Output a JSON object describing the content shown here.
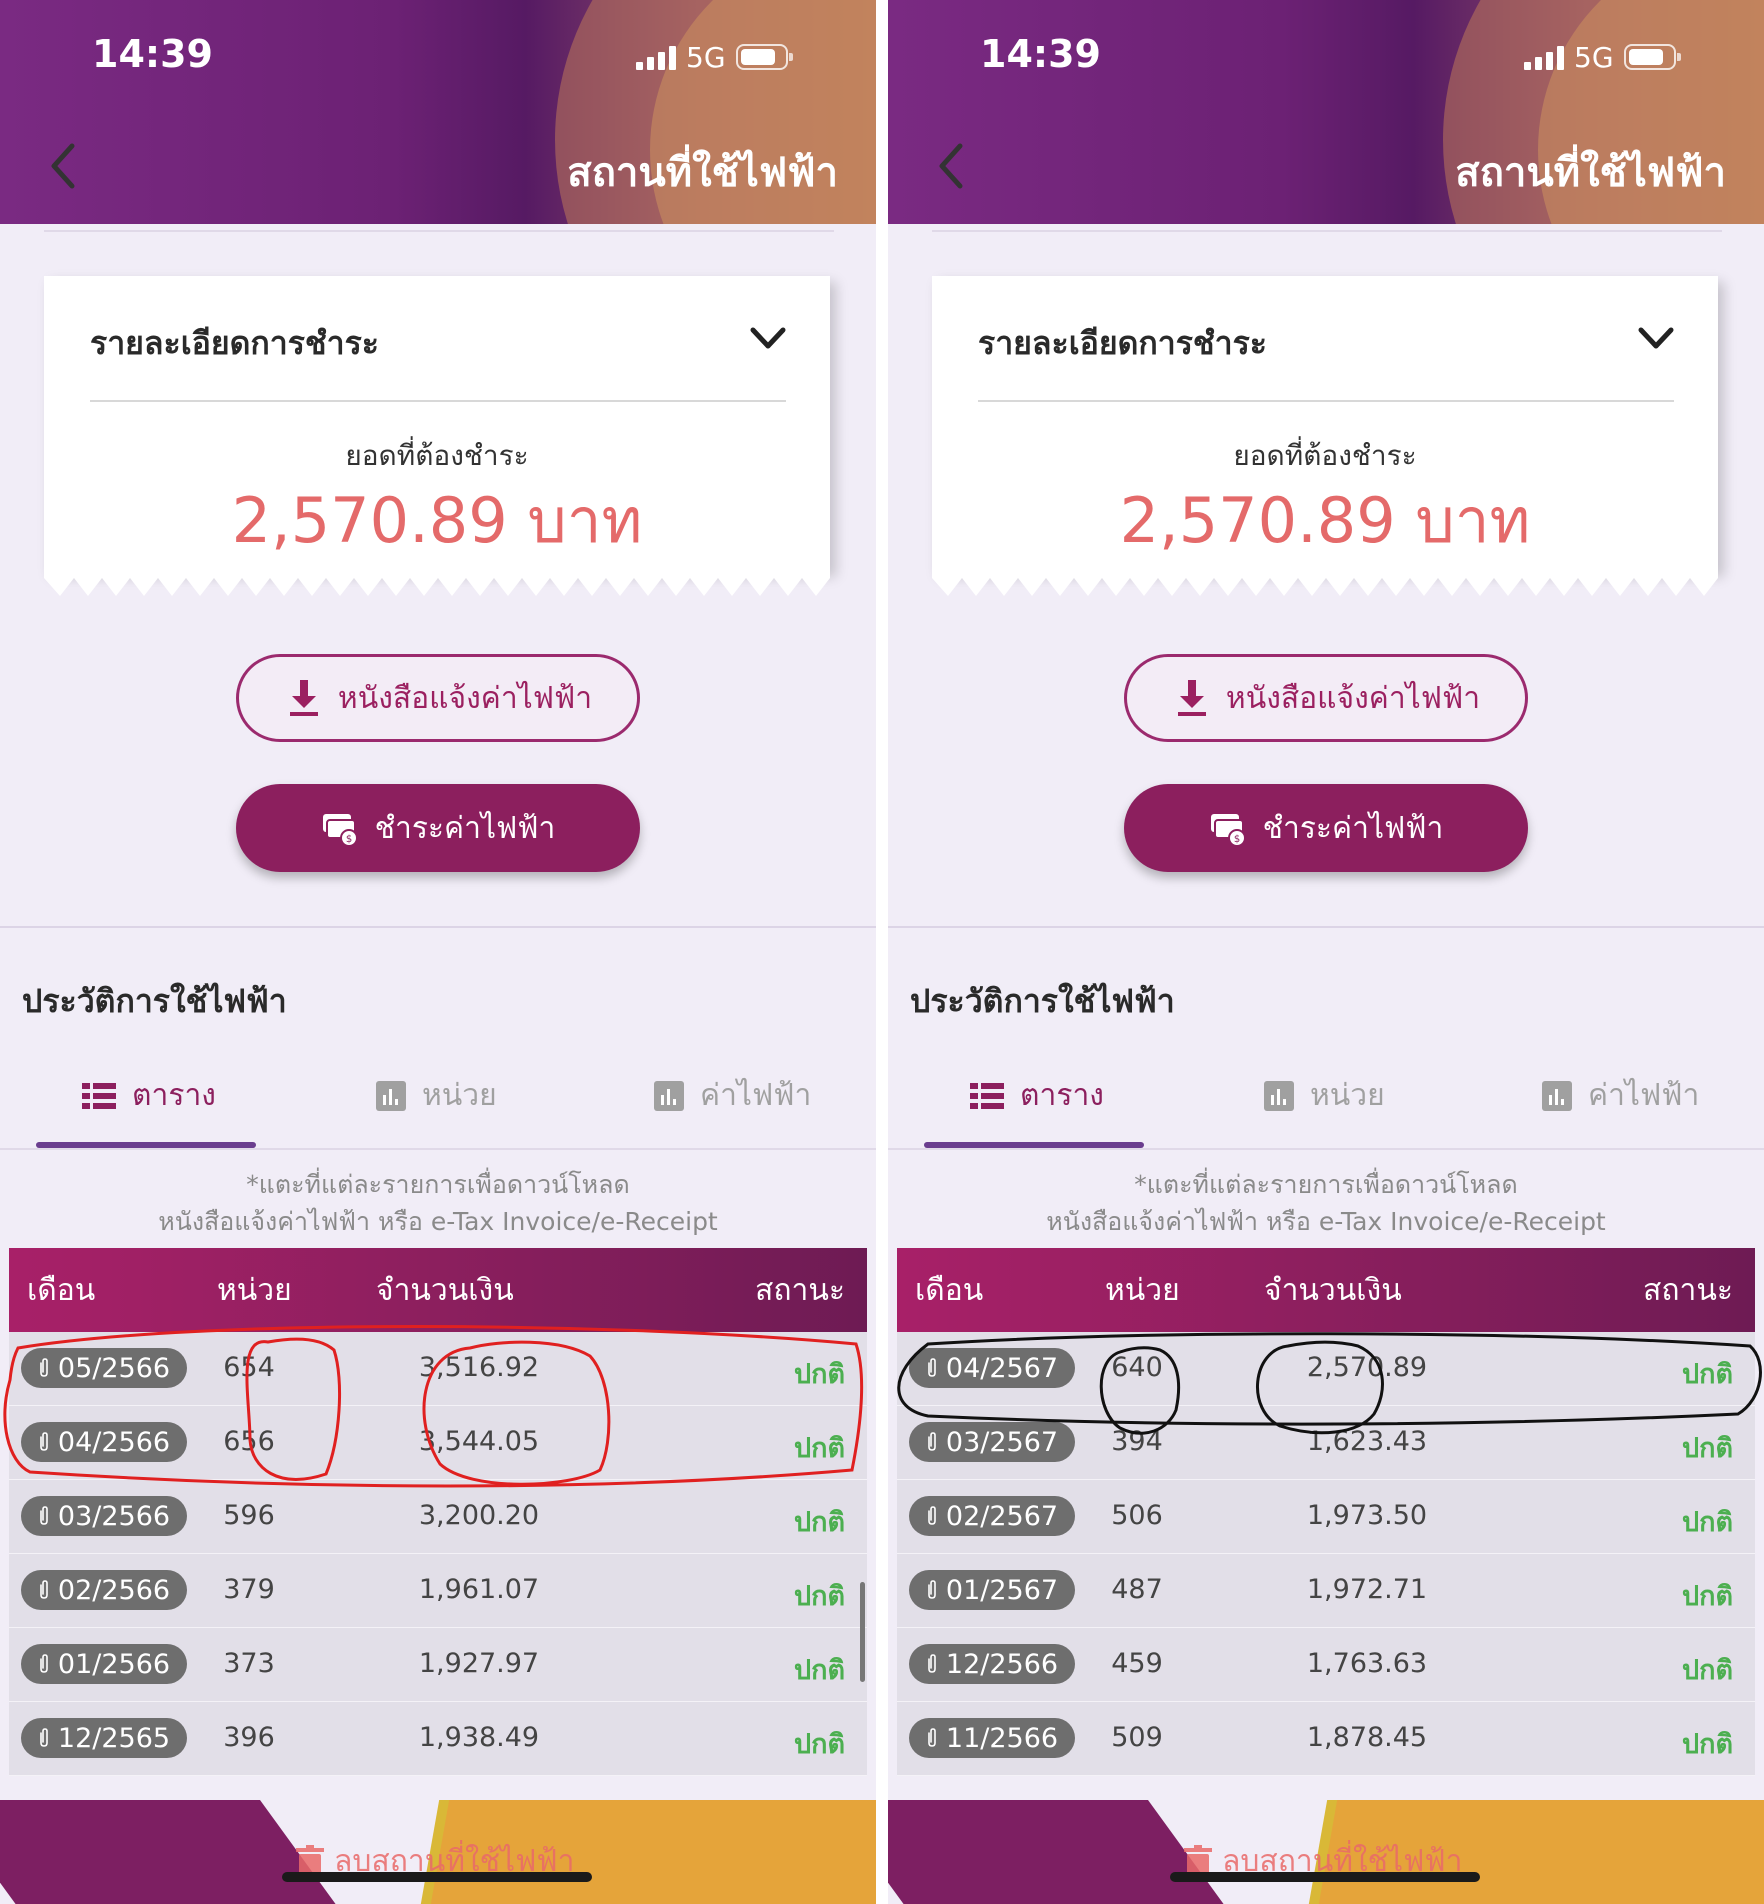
{
  "panels": [
    {
      "status_bar": {
        "time": "14:39",
        "network": "5G"
      },
      "header": {
        "title": "สถานที่ใช้ไฟฟ้า"
      },
      "payment_card": {
        "title": "รายละเอียดการชำระ",
        "due_label": "ยอดที่ต้องชำระ",
        "due_amount": "2,570.89 บาท"
      },
      "buttons": {
        "notice": "หนังสือแจ้งค่าไฟฟ้า",
        "pay": "ชำระค่าไฟฟ้า"
      },
      "history": {
        "title": "ประวัติการใช้ไฟฟ้า",
        "tabs": [
          "ตาราง",
          "หน่วย",
          "ค่าไฟฟ้า"
        ],
        "hint_line1": "*แตะที่แต่ละรายการเพื่อดาวน์โหลด",
        "hint_line2": "หนังสือแจ้งค่าไฟฟ้า หรือ e-Tax Invoice/e-Receipt",
        "columns": [
          "เดือน",
          "หน่วย",
          "จำนวนเงิน",
          "สถานะ"
        ],
        "rows": [
          {
            "month": "05/2566",
            "units": "654",
            "amount": "3,516.92",
            "status": "ปกติ"
          },
          {
            "month": "04/2566",
            "units": "656",
            "amount": "3,544.05",
            "status": "ปกติ"
          },
          {
            "month": "03/2566",
            "units": "596",
            "amount": "3,200.20",
            "status": "ปกติ"
          },
          {
            "month": "02/2566",
            "units": "379",
            "amount": "1,961.07",
            "status": "ปกติ"
          },
          {
            "month": "01/2566",
            "units": "373",
            "amount": "1,927.97",
            "status": "ปกติ"
          },
          {
            "month": "12/2565",
            "units": "396",
            "amount": "1,938.49",
            "status": "ปกติ"
          }
        ]
      },
      "footer": {
        "delete_label": "ลบสถานที่ใช้ไฟฟ้า"
      },
      "annotation_color": "#e02020"
    },
    {
      "status_bar": {
        "time": "14:39",
        "network": "5G"
      },
      "header": {
        "title": "สถานที่ใช้ไฟฟ้า"
      },
      "payment_card": {
        "title": "รายละเอียดการชำระ",
        "due_label": "ยอดที่ต้องชำระ",
        "due_amount": "2,570.89 บาท"
      },
      "buttons": {
        "notice": "หนังสือแจ้งค่าไฟฟ้า",
        "pay": "ชำระค่าไฟฟ้า"
      },
      "history": {
        "title": "ประวัติการใช้ไฟฟ้า",
        "tabs": [
          "ตาราง",
          "หน่วย",
          "ค่าไฟฟ้า"
        ],
        "hint_line1": "*แตะที่แต่ละรายการเพื่อดาวน์โหลด",
        "hint_line2": "หนังสือแจ้งค่าไฟฟ้า หรือ e-Tax Invoice/e-Receipt",
        "columns": [
          "เดือน",
          "หน่วย",
          "จำนวนเงิน",
          "สถานะ"
        ],
        "rows": [
          {
            "month": "04/2567",
            "units": "640",
            "amount": "2,570.89",
            "status": "ปกติ"
          },
          {
            "month": "03/2567",
            "units": "394",
            "amount": "1,623.43",
            "status": "ปกติ"
          },
          {
            "month": "02/2567",
            "units": "506",
            "amount": "1,973.50",
            "status": "ปกติ"
          },
          {
            "month": "01/2567",
            "units": "487",
            "amount": "1,972.71",
            "status": "ปกติ"
          },
          {
            "month": "12/2566",
            "units": "459",
            "amount": "1,763.63",
            "status": "ปกติ"
          },
          {
            "month": "11/2566",
            "units": "509",
            "amount": "1,878.45",
            "status": "ปกติ"
          }
        ]
      },
      "footer": {
        "delete_label": "ลบสถานที่ใช้ไฟฟ้า"
      },
      "annotation_color": "#111111"
    }
  ],
  "colors": {
    "brand_purple": "#8c1f5e",
    "amount_red": "#e46a6a",
    "status_green": "#4caf50",
    "tab_active": "#6a3d8e"
  },
  "icons": [
    "back-arrow-icon",
    "signal-icon",
    "battery-icon",
    "chevron-down-icon",
    "download-icon",
    "payment-card-icon",
    "table-list-icon",
    "bar-chart-icon",
    "paperclip-icon",
    "trash-icon"
  ]
}
